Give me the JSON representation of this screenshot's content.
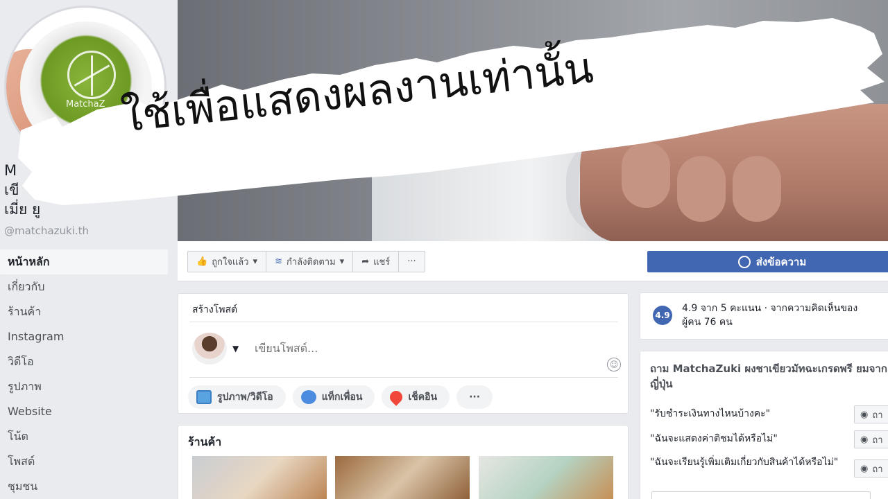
{
  "overlay": {
    "banner_text": "ใช้เพื่อแสดงผลงานเท่านั้น"
  },
  "page": {
    "name_lines": [
      "M",
      "เขี",
      "เมี่ย                ยู"
    ],
    "handle": "@matchazuki.th",
    "logo_text": "MatchaZ"
  },
  "sidebar": {
    "items": [
      {
        "label": "หน้าหลัก",
        "active": true
      },
      {
        "label": "เกี่ยวกับ"
      },
      {
        "label": "ร้านค้า"
      },
      {
        "label": "Instagram"
      },
      {
        "label": "วิดีโอ"
      },
      {
        "label": "รูปภาพ"
      },
      {
        "label": "Website"
      },
      {
        "label": "โน้ต"
      },
      {
        "label": "โพสต์"
      },
      {
        "label": "ชุมชน"
      }
    ]
  },
  "actions": {
    "like_label": "ถูกใจแล้ว",
    "follow_label": "กำลังติดตาม",
    "share_label": "แชร์",
    "more_label": "···",
    "send_message_label": "ส่งข้อความ"
  },
  "create_post": {
    "title": "สร้างโพสต์",
    "placeholder": "เขียนโพสต์...",
    "buttons": [
      {
        "label": "รูปภาพ/วิดีโอ",
        "icon": "photo-icon",
        "color": "#45bd62"
      },
      {
        "label": "แท็กเพื่อน",
        "icon": "tag-friend-icon",
        "color": "#1877f2"
      },
      {
        "label": "เช็คอิน",
        "icon": "location-pin-icon",
        "color": "#f5533d"
      },
      {
        "label": "···",
        "icon": "more-icon"
      }
    ]
  },
  "shop": {
    "title": "ร้านค้า"
  },
  "rating": {
    "score": "4.9",
    "line1": "4.9 จาก 5 คะแนน · จากความคิดเห็นของ",
    "line2": "ผู้คน 76 คน"
  },
  "ask": {
    "title": "ถาม MatchaZuki ผงชาเขียวมัทฉะเกรดพรี ยมจากญี่ปุ่น",
    "questions": [
      "\"รับชำระเงินทางไหนบ้างคะ\"",
      "\"ฉันจะแสดงค่าติชมได้หรือไม่\"",
      "\"ฉันจะเรียนรู้เพิ่มเติมเกี่ยวกับสินค้าได้หรือไม่\""
    ],
    "ask_button_label": "ถา"
  },
  "colors": {
    "brand_blue": "#4267b2",
    "page_bg": "#e9ebee"
  }
}
